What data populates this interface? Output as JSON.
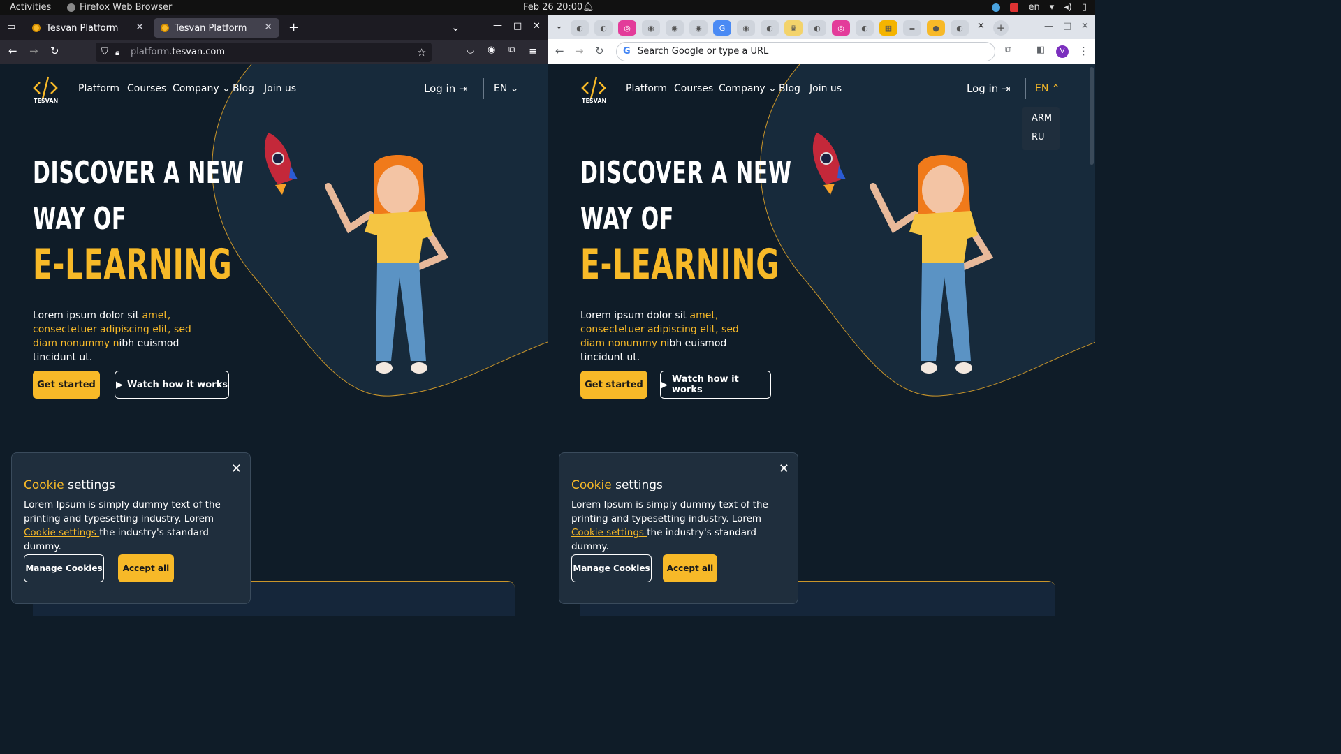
{
  "system": {
    "activities": "Activities",
    "app_name": "Firefox Web Browser",
    "clock": "Feb 26  20:00",
    "keyboard_lang": "en"
  },
  "firefox": {
    "tabs": [
      {
        "title": "Tesvan Platform"
      },
      {
        "title": "Tesvan Platform"
      }
    ],
    "url_host_dim": "platform.",
    "url_host": "tesvan.com"
  },
  "chrome": {
    "omnibox_placeholder": "Search Google or type a URL",
    "profile_initial": "V"
  },
  "site": {
    "logo_text": "TESVAN",
    "nav": [
      "Platform",
      "Courses",
      "Company",
      "Blog",
      "Join us"
    ],
    "login": "Log in",
    "lang": "EN",
    "lang_options": [
      "ARM",
      "RU"
    ],
    "hero": {
      "line1": "DISCOVER A NEW",
      "line2": "WAY OF",
      "line3": "E-LEARNING",
      "desc_a": "Lorem ipsum dolor sit ",
      "desc_b": "amet, consectetuer adipiscing elit, sed diam nonummy n",
      "desc_c": "ibh euismod tincidunt ut."
    },
    "btn_get_started": "Get started",
    "btn_watch": "Watch how it works",
    "cookie": {
      "title_hl": "Cookie",
      "title_rest": " settings",
      "body_a": "Lorem Ipsum is simply dummy text of the printing and typesetting industry. Lorem ",
      "link": "Cookie settings ",
      "body_b": "the industry's standard dummy.",
      "manage": "Manage Cookies",
      "accept": "Accept all"
    }
  },
  "colors": {
    "accent": "#f7b928",
    "background": "#0f1c28",
    "card": "#1f2e3d"
  }
}
